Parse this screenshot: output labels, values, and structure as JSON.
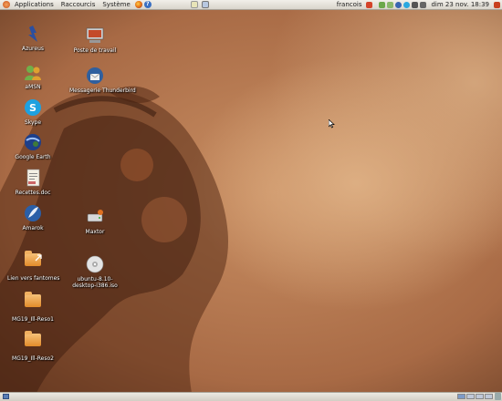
{
  "top_panel": {
    "menus": [
      "Applications",
      "Raccourcis",
      "Système"
    ],
    "user": "francois",
    "clock": "dim 23 nov. 18:39"
  },
  "desktop_icons": [
    {
      "id": "azureus",
      "label": "Azureus",
      "icon": "azureus-frog-icon"
    },
    {
      "id": "amsn",
      "label": "aMSN",
      "icon": "amsn-icon"
    },
    {
      "id": "skype",
      "label": "Skype",
      "icon": "skype-icon"
    },
    {
      "id": "google-earth",
      "label": "Google Earth",
      "icon": "google-earth-icon"
    },
    {
      "id": "recettes",
      "label": "Recettes.doc",
      "icon": "document-icon"
    },
    {
      "id": "amarok",
      "label": "Amarok",
      "icon": "amarok-icon"
    },
    {
      "id": "lien-fantomes",
      "label": "Lien vers fantomes",
      "icon": "folder-link-icon"
    },
    {
      "id": "mg19-reso1",
      "label": "MG19_Ill-Reso1",
      "icon": "folder-icon"
    },
    {
      "id": "mg19-reso2",
      "label": "MG19_Ill-Reso2",
      "icon": "folder-icon"
    },
    {
      "id": "poste-travail",
      "label": "Poste de travail",
      "icon": "computer-icon"
    },
    {
      "id": "thunderbird",
      "label": "Messagerie Thunderbird",
      "icon": "thunderbird-icon"
    },
    {
      "id": "maxtor",
      "label": "Maxtor",
      "icon": "drive-icon"
    },
    {
      "id": "ubuntu-cd",
      "label": "ubuntu-8.10-desktop-i386.iso",
      "icon": "disc-icon"
    }
  ],
  "colors": {
    "panel": "#e6e3dc",
    "wallpaper": "#b57a50",
    "folder": "#e8952f"
  }
}
